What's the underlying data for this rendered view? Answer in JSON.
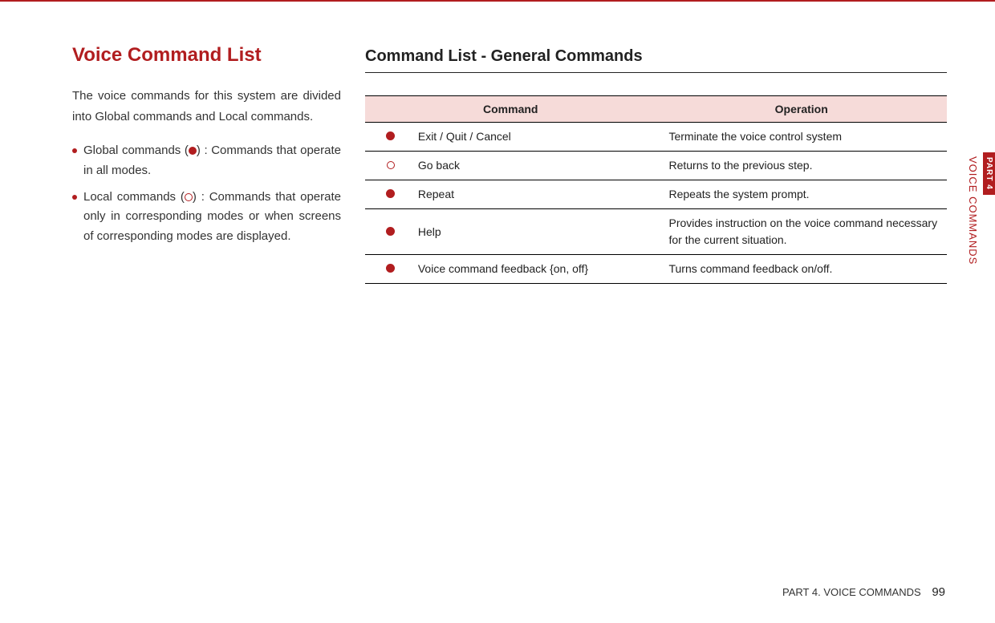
{
  "heading_main": "Voice Command List",
  "intro": "The voice commands for this system are divided into Global commands and Local commands.",
  "bullets": {
    "global_prefix": "Global commands (",
    "global_suffix": ") : Commands that operate in all modes.",
    "local_prefix": "Local commands (",
    "local_suffix": ") : Commands that operate only in corresponding modes or when screens of corresponding modes are displayed."
  },
  "heading_sub": "Command List - General Commands",
  "table": {
    "headers": {
      "command": "Command",
      "operation": "Operation"
    },
    "rows": [
      {
        "type": "filled",
        "command": "Exit / Quit / Cancel",
        "operation": "Terminate the voice control system"
      },
      {
        "type": "outline",
        "command": "Go back",
        "operation": "Returns to the previous step."
      },
      {
        "type": "filled",
        "command": "Repeat",
        "operation": "Repeats the system prompt."
      },
      {
        "type": "filled",
        "command": "Help",
        "operation": "Provides instruction on the voice command necessary for the current situation."
      },
      {
        "type": "filled",
        "command": "Voice command feedback {on, off}",
        "operation": "Turns command feedback on/off."
      }
    ]
  },
  "side_tab": {
    "part": "PART 4",
    "title": "VOICE COMMANDS"
  },
  "footer": {
    "part_label": "PART 4. VOICE COMMANDS",
    "page_number": "99"
  }
}
